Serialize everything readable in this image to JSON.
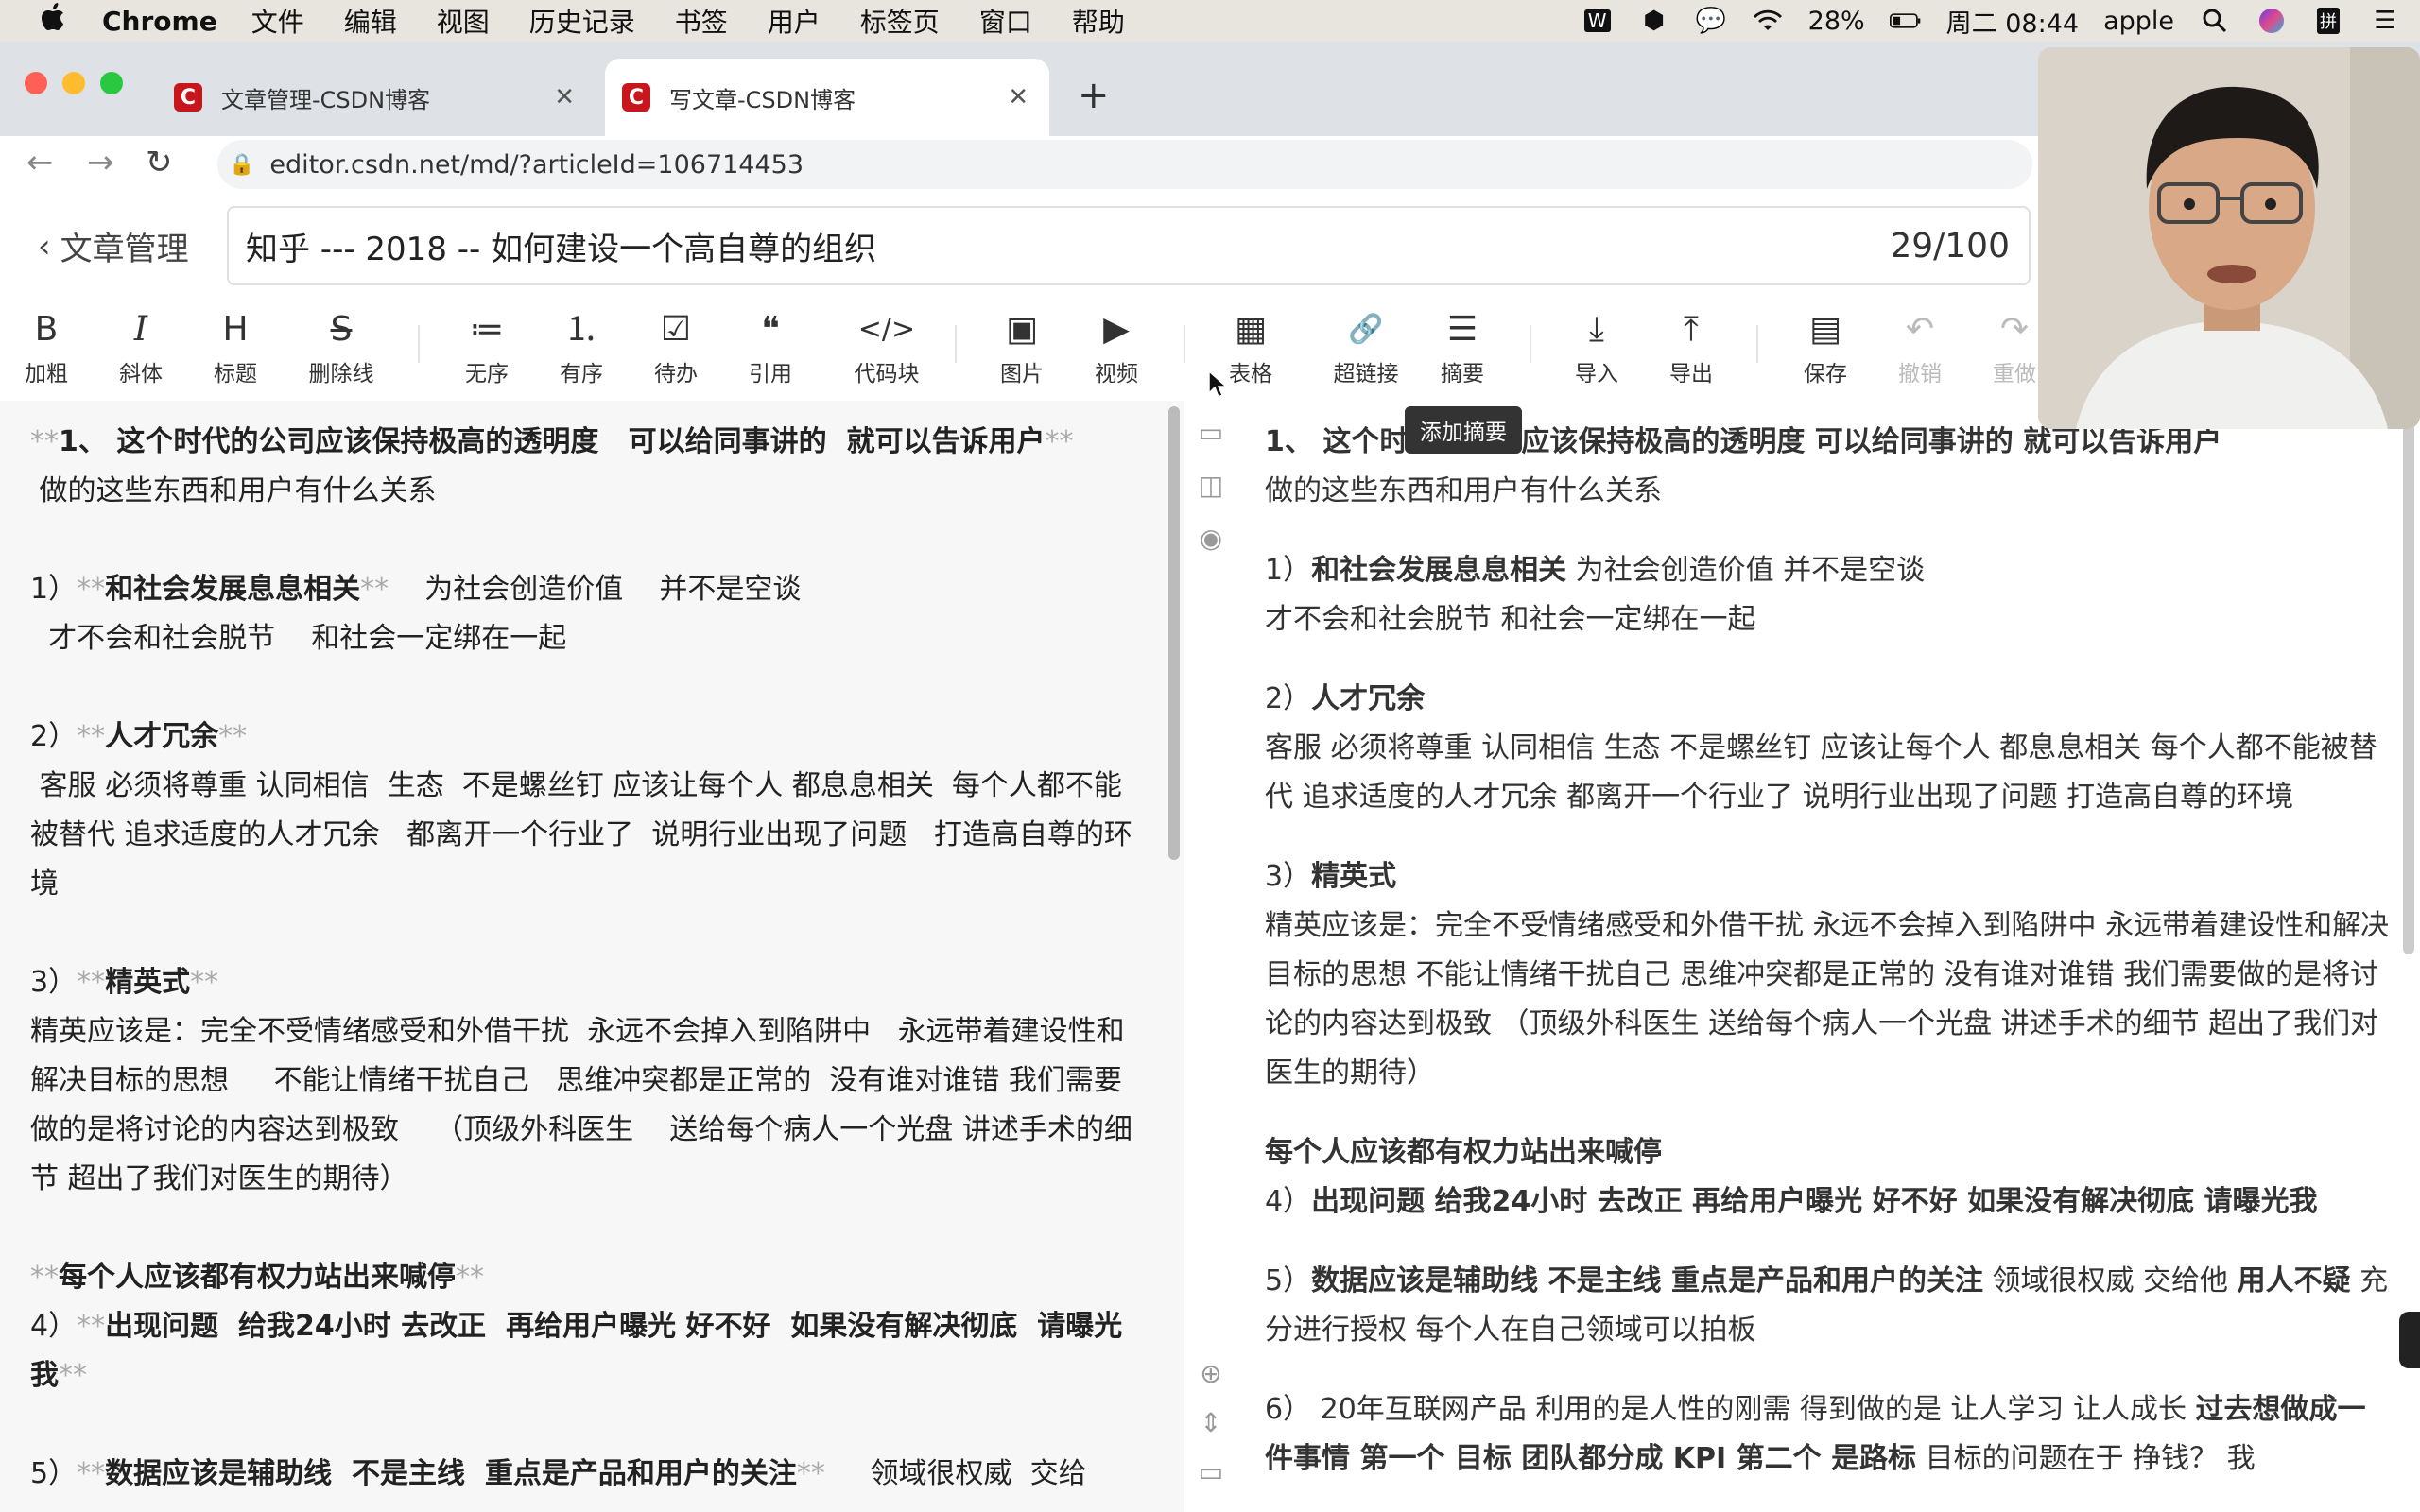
{
  "menubar": {
    "app": "Chrome",
    "menus": [
      "文件",
      "编辑",
      "视图",
      "历史记录",
      "书签",
      "用户",
      "标签页",
      "窗口",
      "帮助"
    ],
    "battery": "28%",
    "clock": "周二 08:44",
    "user": "apple"
  },
  "tabs": [
    {
      "title": "文章管理-CSDN博客",
      "favicon": "C",
      "active": false
    },
    {
      "title": "写文章-CSDN博客",
      "favicon": "C",
      "active": true
    }
  ],
  "address": {
    "url": "editor.csdn.net/md/?articleId=106714453"
  },
  "editor_header": {
    "back_label": "文章管理",
    "title": "知乎 --- 2018  --  如何建设一个高自尊的组织",
    "count": "29/100"
  },
  "toolbar": [
    {
      "icon": "B",
      "label": "加粗"
    },
    {
      "icon": "I",
      "label": "斜体"
    },
    {
      "icon": "H",
      "label": "标题"
    },
    {
      "icon": "S",
      "label": "删除线"
    },
    {
      "icon": "≔",
      "label": "无序"
    },
    {
      "icon": "⒈",
      "label": "有序"
    },
    {
      "icon": "☑",
      "label": "待办"
    },
    {
      "icon": "❝",
      "label": "引用"
    },
    {
      "icon": "</>",
      "label": "代码块"
    },
    {
      "icon": "▣",
      "label": "图片"
    },
    {
      "icon": "▶",
      "label": "视频"
    },
    {
      "icon": "▦",
      "label": "表格"
    },
    {
      "icon": "🔗",
      "label": "超链接"
    },
    {
      "icon": "☰",
      "label": "摘要"
    },
    {
      "icon": "⤓",
      "label": "导入"
    },
    {
      "icon": "⤒",
      "label": "导出"
    },
    {
      "icon": "▤",
      "label": "保存"
    },
    {
      "icon": "↶",
      "label": "撤销"
    },
    {
      "icon": "↷",
      "label": "重做"
    }
  ],
  "tooltip": "添加摘要",
  "editor_lines": [
    {
      "segs": [
        {
          "t": "**",
          "k": "mk"
        },
        {
          "t": "1、 这个时代的公司应该保持极高的透明度   可以给同事讲的  就可以告诉用户",
          "k": "b"
        },
        {
          "t": "**",
          "k": "mk"
        }
      ]
    },
    {
      "segs": [
        {
          "t": " 做的这些东西和用户有什么关系",
          "k": ""
        }
      ]
    },
    {
      "segs": []
    },
    {
      "segs": [
        {
          "t": "1）",
          "k": ""
        },
        {
          "t": "**",
          "k": "mk"
        },
        {
          "t": "和社会发展息息相关",
          "k": "b"
        },
        {
          "t": "**",
          "k": "mk"
        },
        {
          "t": "    为社会创造价值    并不是空谈",
          "k": ""
        }
      ]
    },
    {
      "segs": [
        {
          "t": "  才不会和社会脱节    和社会一定绑在一起",
          "k": ""
        }
      ]
    },
    {
      "segs": []
    },
    {
      "segs": [
        {
          "t": "2）",
          "k": ""
        },
        {
          "t": "**",
          "k": "mk"
        },
        {
          "t": "人才冗余",
          "k": "b"
        },
        {
          "t": "**",
          "k": "mk"
        }
      ]
    },
    {
      "segs": [
        {
          "t": " 客服 必须将尊重 认同相信  生态  不是螺丝钉 应该让每个人 都息息相关  每个人都不能被替代 追求适度的人才冗余   都离开一个行业了  说明行业出现了问题   打造高自尊的环境",
          "k": ""
        }
      ]
    },
    {
      "segs": []
    },
    {
      "segs": [
        {
          "t": "3）",
          "k": ""
        },
        {
          "t": "**",
          "k": "mk"
        },
        {
          "t": "精英式",
          "k": "b"
        },
        {
          "t": "**",
          "k": "mk"
        }
      ]
    },
    {
      "segs": [
        {
          "t": "精英应该是：完全不受情绪感受和外借干扰  永远不会掉入到陷阱中   永远带着建设性和解决目标的思想     不能让情绪干扰自己   思维冲突都是正常的  没有谁对谁错 我们需要做的是将讨论的内容达到极致    （顶级外科医生    送给每个病人一个光盘 讲述手术的细节 超出了我们对医生的期待）",
          "k": ""
        }
      ]
    },
    {
      "segs": []
    },
    {
      "segs": [
        {
          "t": "**",
          "k": "mk"
        },
        {
          "t": "每个人应该都有权力站出来喊停",
          "k": "b"
        },
        {
          "t": "**",
          "k": "mk"
        }
      ]
    },
    {
      "segs": [
        {
          "t": "4）",
          "k": ""
        },
        {
          "t": "**",
          "k": "mk"
        },
        {
          "t": "出现问题  给我24小时 去改正  再给用户曝光 好不好  如果没有解决彻底  请曝光我",
          "k": "b"
        },
        {
          "t": "**",
          "k": "mk"
        }
      ]
    },
    {
      "segs": []
    },
    {
      "segs": [
        {
          "t": "5）",
          "k": ""
        },
        {
          "t": "**",
          "k": "mk"
        },
        {
          "t": "数据应该是辅助线  不是主线  重点是产品和用户的关注",
          "k": "b"
        },
        {
          "t": "**",
          "k": "mk"
        },
        {
          "t": "     领域很权威  交给",
          "k": ""
        }
      ]
    }
  ],
  "preview_blocks": [
    [
      {
        "segs": [
          {
            "t": "1、 这个时代的公司应该保持极高的透明度 可以给同事讲的 就可以告诉用户",
            "k": "b"
          }
        ]
      },
      {
        "segs": [
          {
            "t": "做的这些东西和用户有什么关系",
            "k": ""
          }
        ]
      }
    ],
    [
      {
        "segs": [
          {
            "t": "1）",
            "k": ""
          },
          {
            "t": "和社会发展息息相关",
            "k": "b"
          },
          {
            "t": " 为社会创造价值 并不是空谈",
            "k": ""
          }
        ]
      },
      {
        "segs": [
          {
            "t": "才不会和社会脱节 和社会一定绑在一起",
            "k": ""
          }
        ]
      }
    ],
    [
      {
        "segs": [
          {
            "t": "2）",
            "k": ""
          },
          {
            "t": "人才冗余",
            "k": "b"
          }
        ]
      },
      {
        "segs": [
          {
            "t": "客服 必须将尊重 认同相信 生态 不是螺丝钉 应该让每个人 都息息相关 每个人都不能被替代 追求适度的人才冗余 都离开一个行业了 说明行业出现了问题 打造高自尊的环境",
            "k": ""
          }
        ]
      }
    ],
    [
      {
        "segs": [
          {
            "t": "3）",
            "k": ""
          },
          {
            "t": "精英式",
            "k": "b"
          }
        ]
      },
      {
        "segs": [
          {
            "t": "精英应该是：完全不受情绪感受和外借干扰 永远不会掉入到陷阱中 永远带着建设性和解决目标的思想 不能让情绪干扰自己 思维冲突都是正常的 没有谁对谁错 我们需要做的是将讨论的内容达到极致 （顶级外科医生 送给每个病人一个光盘 讲述手术的细节 超出了我们对医生的期待）",
            "k": ""
          }
        ]
      }
    ],
    [
      {
        "segs": [
          {
            "t": "每个人应该都有权力站出来喊停",
            "k": "b"
          }
        ]
      },
      {
        "segs": [
          {
            "t": "4）",
            "k": ""
          },
          {
            "t": "出现问题 给我24小时 去改正 再给用户曝光 好不好 如果没有解决彻底 请曝光我",
            "k": "b"
          }
        ]
      }
    ],
    [
      {
        "segs": [
          {
            "t": "5）",
            "k": ""
          },
          {
            "t": "数据应该是辅助线 不是主线 重点是产品和用户的关注",
            "k": "b"
          },
          {
            "t": " 领域很权威 交给他 ",
            "k": ""
          },
          {
            "t": "用人不疑",
            "k": "b"
          },
          {
            "t": " 充分进行授权 每个人在自己领域可以拍板",
            "k": ""
          }
        ]
      }
    ],
    [
      {
        "segs": [
          {
            "t": "6） 20年互联网产品 利用的是人性的刚需 得到做的是 让人学习 让人成长 ",
            "k": ""
          },
          {
            "t": "过去想做成一件事情 第一个 目标 团队都分成 KPI 第二个 是路标",
            "k": "b"
          },
          {
            "t": " 目标的问题在于 挣钱？ 我",
            "k": ""
          }
        ]
      }
    ]
  ]
}
